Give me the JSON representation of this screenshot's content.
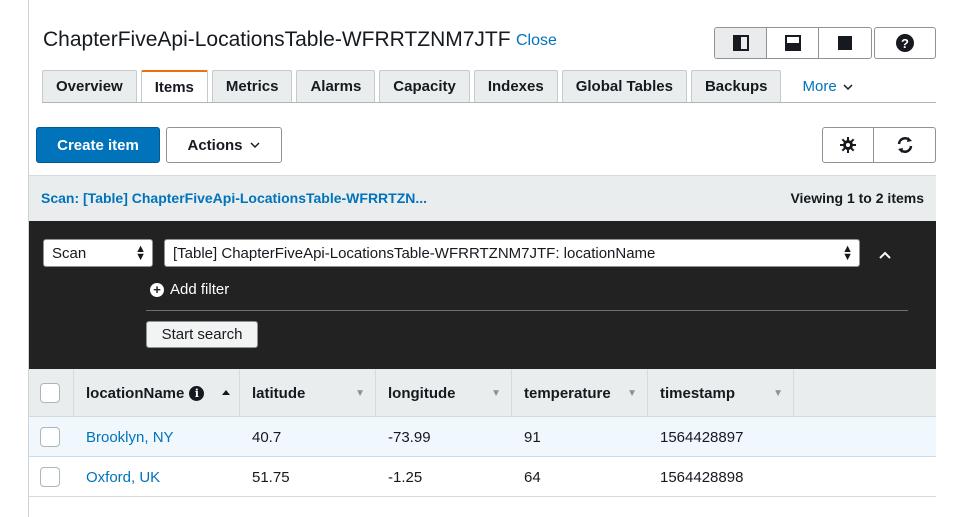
{
  "header": {
    "title": "ChapterFiveApi-LocationsTable-WFRRTZNM7JTF",
    "close_label": "Close"
  },
  "tabs": [
    {
      "label": "Overview"
    },
    {
      "label": "Items"
    },
    {
      "label": "Metrics"
    },
    {
      "label": "Alarms"
    },
    {
      "label": "Capacity"
    },
    {
      "label": "Indexes"
    },
    {
      "label": "Global Tables"
    },
    {
      "label": "Backups"
    }
  ],
  "tabs_more_label": "More",
  "toolbar": {
    "create_label": "Create item",
    "actions_label": "Actions"
  },
  "scan_bar": {
    "title": "Scan: [Table] ChapterFiveApi-LocationsTable-WFRRTZN...",
    "viewing": "Viewing 1 to 2 items"
  },
  "filter": {
    "mode": "Scan",
    "target": "[Table] ChapterFiveApi-LocationsTable-WFRRTZNM7JTF: locationName",
    "add_filter_label": "Add filter",
    "start_search_label": "Start search"
  },
  "table": {
    "columns": [
      "locationName",
      "latitude",
      "longitude",
      "temperature",
      "timestamp"
    ],
    "rows": [
      [
        "Brooklyn, NY",
        "40.7",
        "-73.99",
        "91",
        "1564428897"
      ],
      [
        "Oxford, UK",
        "51.75",
        "-1.25",
        "64",
        "1564428898"
      ]
    ]
  },
  "colors": {
    "primary": "#0073bb",
    "active_tab": "#ec7211",
    "filter_panel": "#222222",
    "selected_row": "#f1f8fd"
  },
  "icons": [
    "layout-split-vertical-icon",
    "layout-split-horizontal-icon",
    "layout-full-icon",
    "help-icon",
    "gear-icon",
    "refresh-icon",
    "chevron-up-icon",
    "plus-circle-icon",
    "info-icon"
  ]
}
